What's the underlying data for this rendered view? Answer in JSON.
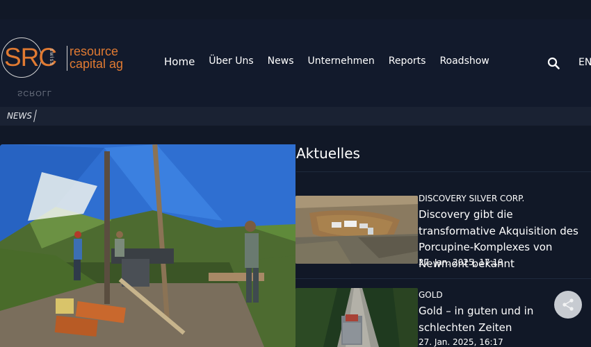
{
  "logo": {
    "mark": "SRC",
    "vertical": "swiss",
    "line1": "resource",
    "line2": "capital ag",
    "colors": {
      "accent": "#e07a32",
      "outline": "#d4d4d4"
    }
  },
  "scroll_label": "SCROLL",
  "nav": {
    "items": [
      {
        "label": "Home",
        "active": true
      },
      {
        "label": "Über Uns"
      },
      {
        "label": "News"
      },
      {
        "label": "Unternehmen"
      },
      {
        "label": "Reports"
      },
      {
        "label": "Roadshow"
      }
    ],
    "search_icon": "search-icon",
    "language": "EN"
  },
  "breadcrumb": {
    "current": "NEWS"
  },
  "hero": {
    "icon": "drill-site-photo"
  },
  "section": {
    "title": "Aktuelles"
  },
  "articles": [
    {
      "category": "DISCOVERY SILVER CORP.",
      "title": "Discovery gibt die transformative Akquisition des Porcupine-Komplexes von Newmont bekannt",
      "date": "27. Jan. 2025, 17:19"
    },
    {
      "category": "GOLD",
      "title": "Gold – in guten und in schlechten Zeiten",
      "date": "27. Jan. 2025, 16:17"
    }
  ],
  "share": {
    "icon": "share-icon"
  },
  "colors": {
    "background": "#111827",
    "header": "#121a2c",
    "breadcrumb_bar": "#1a2233",
    "text": "#ffffff"
  }
}
